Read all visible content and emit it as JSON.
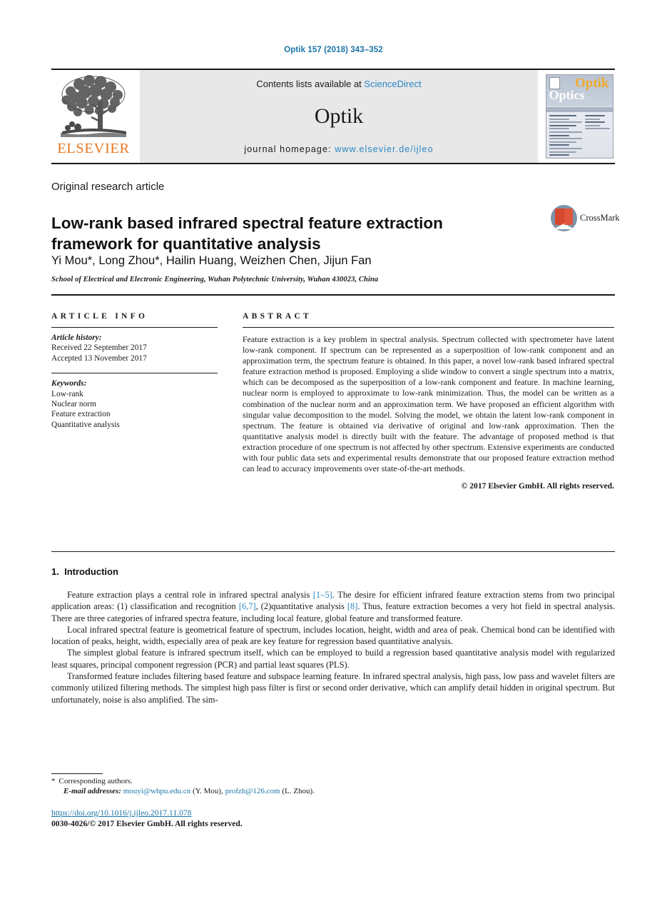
{
  "running_head": "Optik 157 (2018) 343–352",
  "masthead": {
    "publisher_logo_label": "ELSEVIER",
    "contents_prefix": "Contents lists available at ",
    "contents_link": "ScienceDirect",
    "journal_name": "Optik",
    "homepage_prefix": "journal homepage: ",
    "homepage_url": "www.elsevier.de/ijleo",
    "cover": {
      "title_primary": "Optik",
      "title_secondary": "Optics"
    }
  },
  "article": {
    "type": "Original research article",
    "title": "Low-rank based infrared spectral feature extraction framework for quantitative analysis",
    "authors": "Yi Mou*, Long Zhou*, Hailin Huang, Weizhen Chen, Jijun Fan",
    "affiliation": "School of Electrical and Electronic Engineering, Wuhan Polytechnic University, Wuhan 430023, China",
    "crossmark_label": "CrossMark"
  },
  "article_info": {
    "heading": "ARTICLE INFO",
    "history_label": "Article history:",
    "received": "Received 22 September 2017",
    "accepted": "Accepted 13 November 2017",
    "keywords_label": "Keywords:",
    "keywords": [
      "Low-rank",
      "Nuclear norm",
      "Feature extraction",
      "Quantitative analysis"
    ]
  },
  "abstract": {
    "heading": "ABSTRACT",
    "body": "Feature extraction is a key problem in spectral analysis. Spectrum collected with spectrometer have latent low-rank component. If spectrum can be represented as a superposition of low-rank component and an approximation term, the spectrum feature is obtained. In this paper, a novel low-rank based infrared spectral feature extraction method is proposed. Employing a slide window to convert a single spectrum into a matrix, which can be decomposed as the superposition of a low-rank component and feature. In machine learning, nuclear norm is employed to approximate to low-rank minimization. Thus, the model can be written as a combination of the nuclear norm and an approximation term. We have proposed an efficient algorithm with singular value decomposition to the model. Solving the model, we obtain the latent low-rank component in spectrum. The feature is obtained via derivative of original and low-rank approximation. Then the quantitative analysis model is directly built with the feature. The advantage of proposed method is that extraction procedure of one spectrum is not affected by other spectrum. Extensive experiments are conducted with four public data sets and experimental results demonstrate that our proposed feature extraction method can lead to accuracy improvements over state-of-the-art methods.",
    "copyright": "© 2017 Elsevier GmbH. All rights reserved."
  },
  "body": {
    "section_number": "1.",
    "section_title": "Introduction",
    "paragraphs": [
      {
        "parts": [
          {
            "t": "Feature extraction plays a central role in infrared spectral analysis "
          },
          {
            "t": "[1–5]",
            "link": true
          },
          {
            "t": ". The desire for efficient infrared feature extraction stems from two principal application areas: (1) classification and recognition "
          },
          {
            "t": "[6,7]",
            "link": true
          },
          {
            "t": ", (2)quantitative analysis "
          },
          {
            "t": "[8]",
            "link": true
          },
          {
            "t": ". Thus, feature extraction becomes a very hot field in spectral analysis. There are three categories of infrared spectra feature, including local feature, global feature and transformed feature."
          }
        ]
      },
      {
        "parts": [
          {
            "t": "Local infrared spectral feature is geometrical feature of spectrum, includes location, height, width and area of peak. Chemical bond can be identified with location of peaks, height, width, especially area of peak are key feature for regression based quantitative analysis."
          }
        ]
      },
      {
        "parts": [
          {
            "t": "The simplest global feature is infrared spectrum itself, which can be employed to build a regression based quantitative analysis model with regularized least squares, principal component regression (PCR) and partial least squares (PLS)."
          }
        ]
      },
      {
        "parts": [
          {
            "t": "Transformed feature includes filtering based feature and subspace learning feature. In infrared spectral analysis, high pass, low pass and wavelet filters are commonly utilized filtering methods. The simplest high pass filter is first or second order derivative, which can amplify detail hidden in original spectrum. But unfortunately, noise is also amplified. The sim-"
          }
        ]
      }
    ]
  },
  "footnotes": {
    "star": "*",
    "corresponding": "Corresponding authors.",
    "email_label": "E-mail addresses:",
    "email_1": "mouyi@whpu.edu.cn",
    "email_1_owner": "(Y. Mou),",
    "email_2": "profzh@126.com",
    "email_2_owner": "(L. Zhou)."
  },
  "doi": {
    "url": "https://doi.org/10.1016/j.ijleo.2017.11.078",
    "issn_line": "0030-4026/© 2017 Elsevier GmbH. All rights reserved."
  },
  "colors": {
    "link": "#2b86c5",
    "doi_link": "#1a75a7",
    "elsevier_orange": "#e87722",
    "band_gray": "#e8e8e8"
  }
}
